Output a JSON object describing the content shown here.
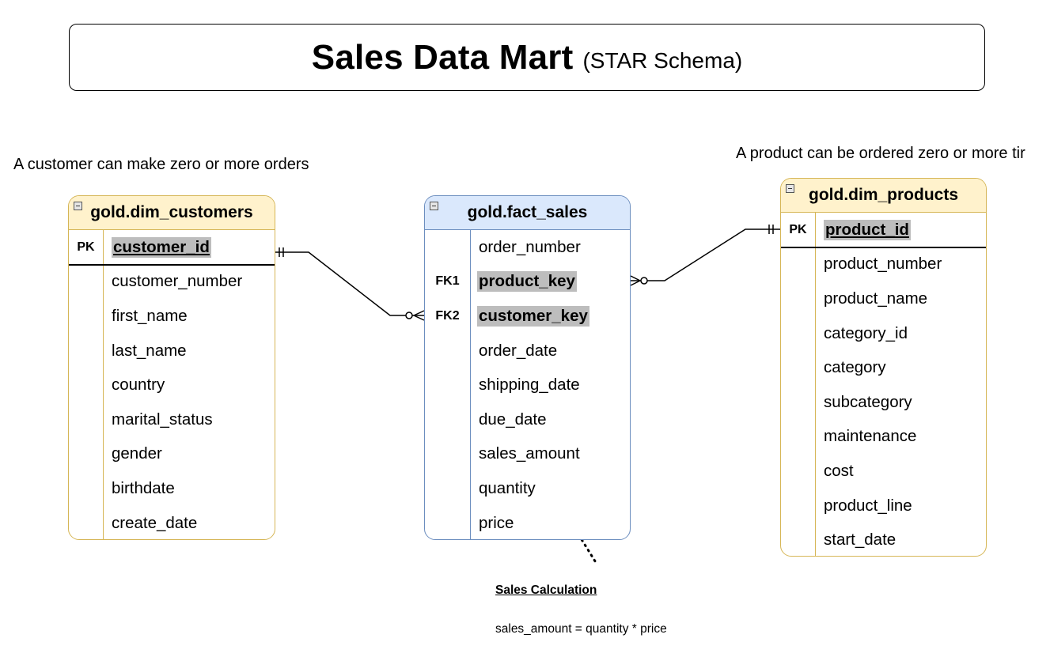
{
  "title": {
    "main": "Sales Data Mart",
    "sub": "(STAR Schema)"
  },
  "notes": {
    "customer": "A customer can make zero or more orders",
    "product": "A product can be ordered zero or more tir"
  },
  "tables": {
    "customers": {
      "name": "gold.dim_customers",
      "pk_label": "PK",
      "pk_field": "customer_id",
      "fields": [
        "customer_number",
        "first_name",
        "last_name",
        "country",
        "marital_status",
        "gender",
        "birthdate",
        "create_date"
      ]
    },
    "fact": {
      "name": "gold.fact_sales",
      "rows": [
        {
          "key": "",
          "field": "order_number"
        },
        {
          "key": "FK1",
          "field": "product_key"
        },
        {
          "key": "FK2",
          "field": "customer_key"
        },
        {
          "key": "",
          "field": "order_date"
        },
        {
          "key": "",
          "field": "shipping_date"
        },
        {
          "key": "",
          "field": "due_date"
        },
        {
          "key": "",
          "field": "sales_amount"
        },
        {
          "key": "",
          "field": "quantity"
        },
        {
          "key": "",
          "field": "price"
        }
      ]
    },
    "products": {
      "name": "gold.dim_products",
      "pk_label": "PK",
      "pk_field": "product_id",
      "fields": [
        "product_number",
        "product_name",
        "category_id",
        "category",
        "subcategory",
        "maintenance",
        "cost",
        "product_line",
        "start_date"
      ]
    }
  },
  "calculation": {
    "title": "Sales Calculation",
    "formula": "sales_amount = quantity * price"
  },
  "colors": {
    "dim_header_bg": "#fff2cc",
    "dim_border": "#d6b656",
    "fact_header_bg": "#dae8fc",
    "fact_border": "#6c8ebf",
    "highlight": "#bdbdbd"
  }
}
